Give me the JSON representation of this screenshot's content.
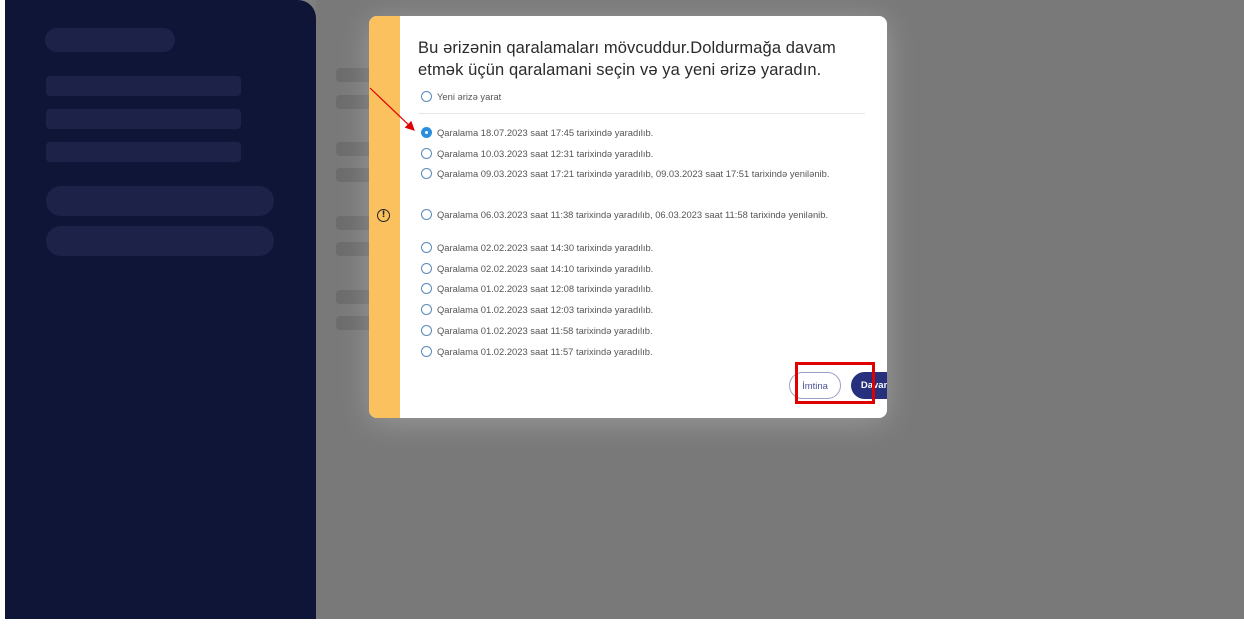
{
  "dialog": {
    "title": "Bu ərizənin qaralamaları mövcuddur.Doldurmağa davam etmək üçün qaralamani seçin və ya yeni ərizə yaradın.",
    "new_option": "Yeni ərizə yarat",
    "drafts": [
      {
        "label": "Qaralama 18.07.2023 saat 17:45 tarixində yaradılıb.",
        "checked": true
      },
      {
        "label": "Qaralama 10.03.2023 saat 12:31 tarixində yaradılıb.",
        "checked": false
      },
      {
        "label": "Qaralama 09.03.2023 saat 17:21 tarixində yaradılıb, 09.03.2023 saat 17:51 tarixində yenilənib.",
        "checked": false
      },
      {
        "label": "Qaralama 06.03.2023 saat 11:38 tarixində yaradılıb, 06.03.2023 saat 11:58 tarixində yenilənib.",
        "checked": false
      },
      {
        "label": "Qaralama 02.02.2023 saat 14:30 tarixində yaradılıb.",
        "checked": false
      },
      {
        "label": "Qaralama 02.02.2023 saat 14:10 tarixində yaradılıb.",
        "checked": false
      },
      {
        "label": "Qaralama 01.02.2023 saat 12:08 tarixində yaradılıb.",
        "checked": false
      },
      {
        "label": "Qaralama 01.02.2023 saat 12:03 tarixində yaradılıb.",
        "checked": false
      },
      {
        "label": "Qaralama 01.02.2023 saat 11:58 tarixində yaradılıb.",
        "checked": false
      },
      {
        "label": "Qaralama 01.02.2023 saat 11:57 tarixində yaradılıb.",
        "checked": false
      }
    ],
    "cancel_label": "İmtina",
    "continue_label": "Davam et",
    "warning_icon": "exclamation-circle-icon"
  },
  "colors": {
    "sidebar": "#1e2a6e",
    "warning_stripe": "#fbc15e",
    "primary_button": "#26307c",
    "radio_checked": "#2a8ee0",
    "annotation": "#e00000"
  }
}
